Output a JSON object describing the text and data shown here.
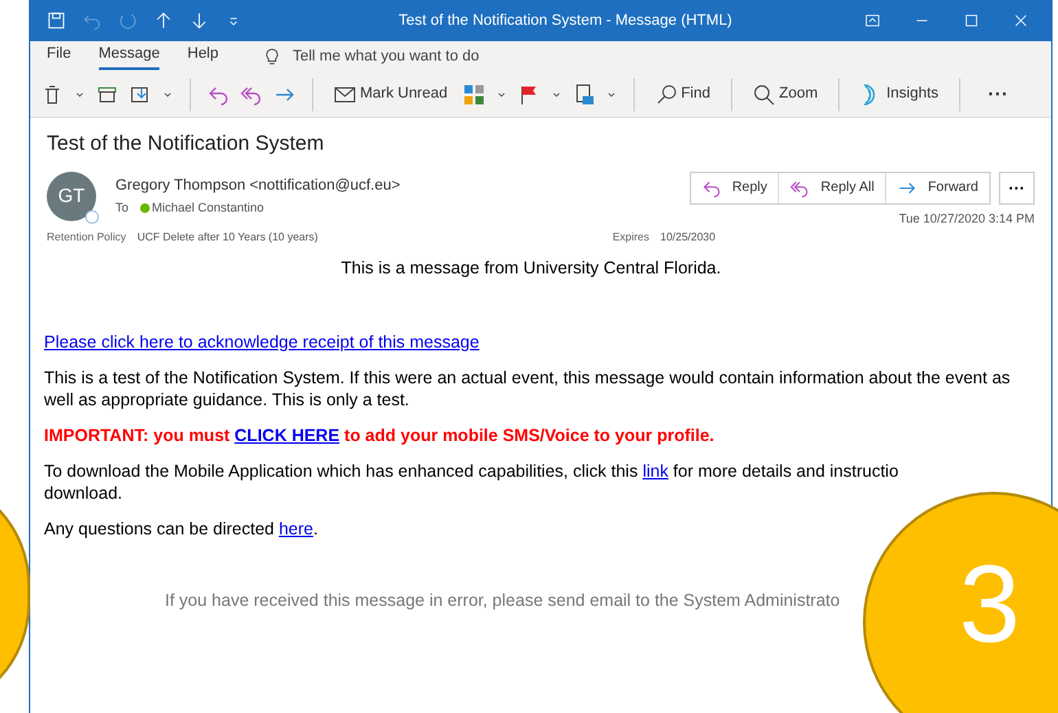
{
  "window": {
    "title": "Test of the Notification System  -  Message (HTML)"
  },
  "menu": [
    {
      "label": "File",
      "selected": false
    },
    {
      "label": "Message",
      "selected": true
    },
    {
      "label": "Help",
      "selected": false
    }
  ],
  "tell_me": {
    "placeholder": "Tell me what you want to do"
  },
  "toolbar": [
    {
      "kind": "delete"
    },
    {
      "kind": "archive"
    },
    {
      "kind": "move"
    },
    {
      "kind": "sep"
    },
    {
      "kind": "reply"
    },
    {
      "kind": "replyall"
    },
    {
      "kind": "forward"
    },
    {
      "kind": "sep"
    },
    {
      "kind": "unread",
      "label": "Mark Unread"
    },
    {
      "kind": "categorize"
    },
    {
      "kind": "flag"
    },
    {
      "kind": "rules"
    },
    {
      "kind": "sep"
    },
    {
      "kind": "find",
      "label": "Find"
    },
    {
      "kind": "sep"
    },
    {
      "kind": "zoom",
      "label": "Zoom"
    },
    {
      "kind": "sep"
    },
    {
      "kind": "insights",
      "label": "Insights"
    },
    {
      "kind": "sep"
    },
    {
      "kind": "more",
      "label": "···"
    }
  ],
  "message": {
    "subject": "Test of the Notification System",
    "avatar": "GT",
    "sender": "Gregory Thompson <nottification@ucf.eu>",
    "to_label": "To",
    "recipient": "Michael Constantino",
    "retention_label": "Retention Policy",
    "retention": "UCF Delete after 10 Years (10 years)",
    "expires_label": "Expires",
    "expires": "10/25/2030",
    "date": "Tue 10/27/2020 3:14 PM",
    "actions": [
      {
        "kind": "reply",
        "label": "Reply"
      },
      {
        "kind": "replyall",
        "label": "Reply All"
      },
      {
        "kind": "forward",
        "label": "Forward"
      },
      {
        "kind": "more",
        "label": "···"
      }
    ]
  },
  "body": [
    {
      "kind": "center",
      "text": "This is a message from University Central Florida."
    },
    {
      "kind": "spacer"
    },
    {
      "kind": "link",
      "text": "Please click here to acknowledge receipt of this message"
    },
    {
      "kind": "para",
      "text": "This is a test of the Notification System. If this were an actual event, this message would contain information about the event as well as appropriate guidance. This is only a test."
    },
    {
      "kind": "important",
      "before": "IMPORTANT: you must ",
      "link": "CLICK HERE",
      "after": " to add your mobile SMS/Voice to your profile."
    },
    {
      "kind": "inline",
      "before": "To download the Mobile Application which has enhanced capabilities, click this ",
      "link": "link",
      "after": " for more details and instructio",
      "line2": "download."
    },
    {
      "kind": "inline",
      "before": "Any questions can be directed ",
      "link": "here",
      "after": "."
    },
    {
      "kind": "footer",
      "text": "If you have received this message in error, please send email to the System Administrato"
    }
  ],
  "callout": {
    "number": "3"
  }
}
